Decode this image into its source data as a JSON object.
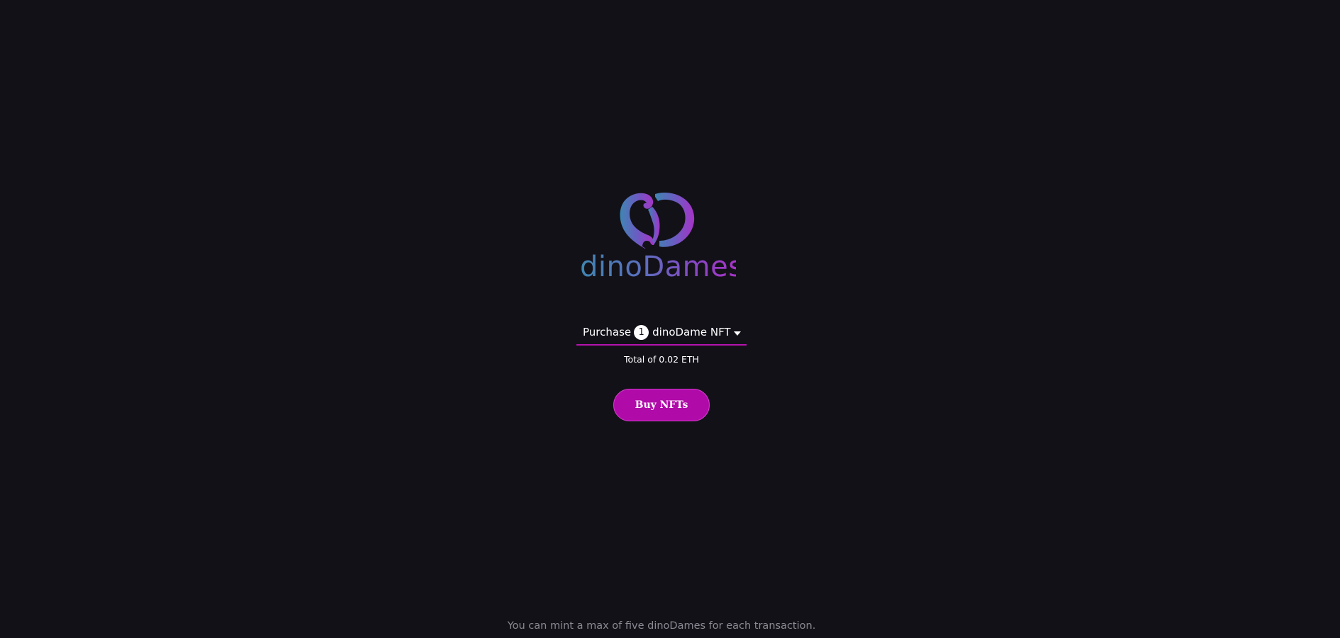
{
  "brand": {
    "name": "dinoDames",
    "logo_icon": "dino-heart-logo-icon",
    "gradient_start": "#3f86b2",
    "gradient_end": "#a733c7"
  },
  "purchase": {
    "prefix": "Purchase",
    "quantity": "1",
    "suffix": "dinoDame NFT",
    "dropdown_icon": "caret-down-icon",
    "underline_color": "#b412ad"
  },
  "total_text": "Total of 0.02 ETH",
  "buy_button": {
    "label": "Buy NFTs",
    "color": "#b00aa9"
  },
  "footer_note": "You can mint a max of five dinoDames for each transaction.",
  "colors": {
    "background": "#131118",
    "text": "#ffffff",
    "muted_text": "#8a8891"
  }
}
